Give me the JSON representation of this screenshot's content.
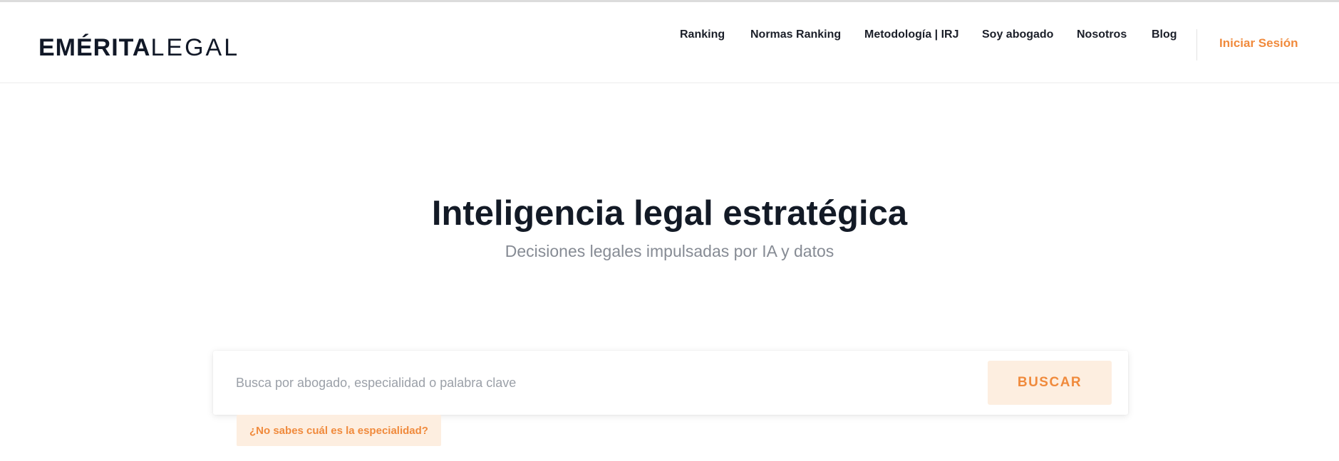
{
  "brand": {
    "name_strong": "EMÉRITA",
    "name_light": "LEGAL",
    "accent_color": "#f08a3c"
  },
  "nav": {
    "items": [
      {
        "label": "Ranking"
      },
      {
        "label": "Normas Ranking"
      },
      {
        "label": "Metodología | IRJ"
      },
      {
        "label": "Soy abogado"
      },
      {
        "label": "Nosotros"
      },
      {
        "label": "Blog"
      }
    ],
    "login_label": "Iniciar Sesión"
  },
  "hero": {
    "title": "Inteligencia legal estratégica",
    "subtitle": "Decisiones legales impulsadas por IA y datos"
  },
  "search": {
    "placeholder": "Busca por abogado, especialidad o palabra clave",
    "value": "",
    "button_label": "BUSCAR",
    "help_label": "¿No sabes cuál es la especialidad?"
  },
  "colors": {
    "accent": "#f08a3c",
    "accent_soft": "#fdeee0",
    "text_dark": "#131a26",
    "text_muted": "#868b94"
  }
}
